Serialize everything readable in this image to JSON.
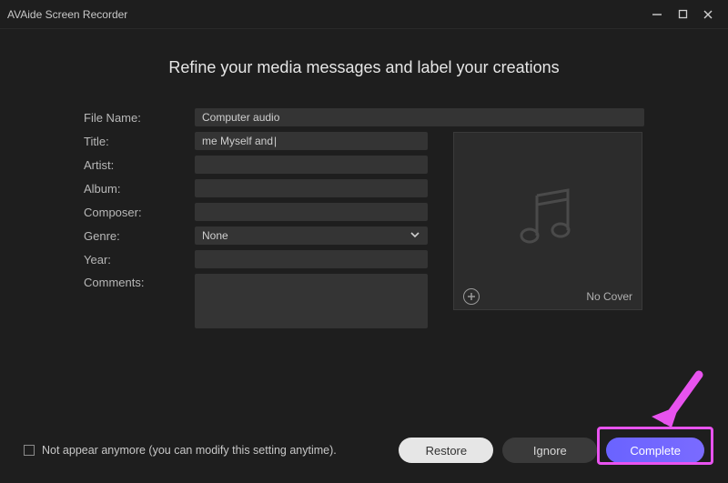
{
  "window": {
    "title": "AVAide Screen Recorder"
  },
  "heading": "Refine your media messages and label your creations",
  "labels": {
    "fileName": "File Name:",
    "title": "Title:",
    "artist": "Artist:",
    "album": "Album:",
    "composer": "Composer:",
    "genre": "Genre:",
    "year": "Year:",
    "comments": "Comments:"
  },
  "values": {
    "fileName": "Computer audio",
    "title": "me Myself and ",
    "artist": "",
    "album": "",
    "composer": "",
    "genre": "None",
    "year": "",
    "comments": ""
  },
  "cover": {
    "noCover": "No Cover"
  },
  "footer": {
    "checkboxLabel": "Not appear anymore (you can modify this setting anytime).",
    "restore": "Restore",
    "ignore": "Ignore",
    "complete": "Complete"
  },
  "annotation": {
    "highlightTarget": "complete-button",
    "arrowColor": "#e853ef"
  }
}
